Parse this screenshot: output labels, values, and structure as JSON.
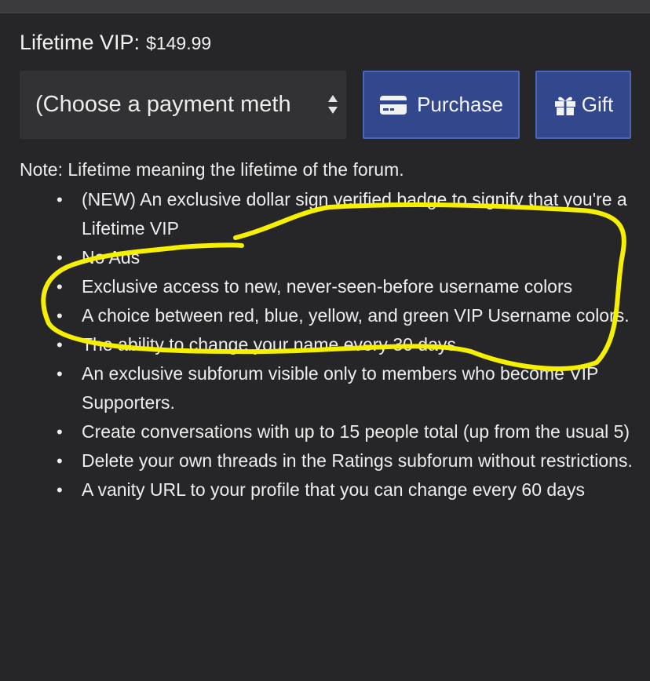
{
  "header": {
    "title": "Lifetime VIP:",
    "price": "$149.99"
  },
  "payment": {
    "selected": "(Choose a payment meth",
    "options_visible": [
      "(Choose a payment meth"
    ]
  },
  "buttons": {
    "purchase_label": "Purchase",
    "purchase_icon": "credit-card-icon",
    "gift_label": "Gift",
    "gift_icon": "gift-icon"
  },
  "colors": {
    "button_bg": "#33478c",
    "highlight": "#f5f000"
  },
  "note": "Note: Lifetime meaning the lifetime of the forum.",
  "features": [
    "(NEW) An exclusive dollar sign verified badge to signify that you're a Lifetime VIP",
    "No Ads",
    "Exclusive access to new, never-seen-before username colors",
    "A choice between red, blue, yellow, and green VIP Username colors.",
    "The ability to change your name every 30 days.",
    "An exclusive subforum visible only to members who become VIP Supporters.",
    "Create conversations with up to 15 people total (up from the usual 5)",
    "Delete your own threads in the Ratings subforum without restrictions.",
    "A vanity URL to your profile that you can change every 60 days"
  ]
}
